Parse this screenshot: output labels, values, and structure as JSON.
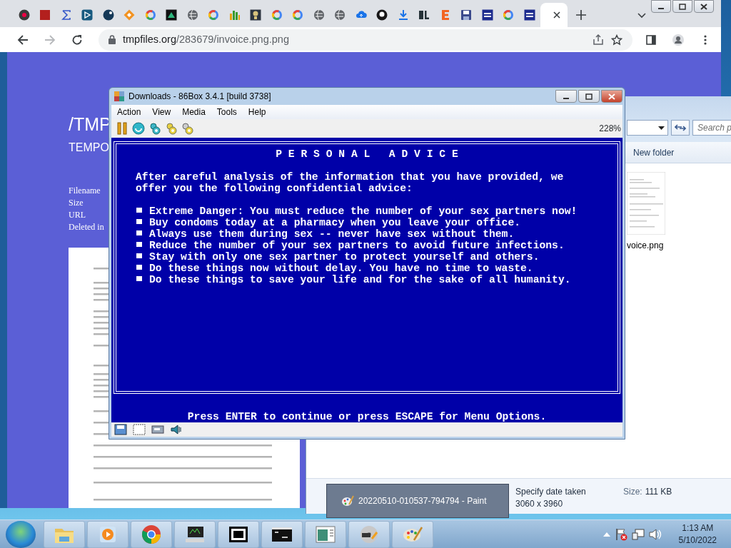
{
  "browser": {
    "tabs": [
      {
        "kind": "vb",
        "selected": false
      },
      {
        "kind": "red",
        "selected": false
      },
      {
        "kind": "sigma",
        "selected": false
      },
      {
        "kind": "play",
        "selected": false
      },
      {
        "kind": "dark",
        "selected": false
      },
      {
        "kind": "diamond",
        "selected": false
      },
      {
        "kind": "google",
        "selected": false
      },
      {
        "kind": "triangle",
        "selected": false
      },
      {
        "kind": "globe",
        "selected": false
      },
      {
        "kind": "google",
        "selected": false
      },
      {
        "kind": "chart",
        "selected": false
      },
      {
        "kind": "help",
        "selected": false
      },
      {
        "kind": "google",
        "selected": false
      },
      {
        "kind": "google",
        "selected": false
      },
      {
        "kind": "globe",
        "selected": false
      },
      {
        "kind": "globe",
        "selected": false
      },
      {
        "kind": "cloud",
        "selected": false
      },
      {
        "kind": "github",
        "selected": false
      },
      {
        "kind": "download",
        "selected": false
      },
      {
        "kind": "sl",
        "selected": false
      },
      {
        "kind": "e",
        "selected": false
      },
      {
        "kind": "save",
        "selected": false
      },
      {
        "kind": "sw",
        "selected": false
      },
      {
        "kind": "google",
        "selected": false
      },
      {
        "kind": "sw",
        "selected": false
      },
      {
        "kind": "blank",
        "selected": true
      }
    ],
    "address": {
      "domain": "tmpfiles.org",
      "path": "/283679/invoice.png.png"
    }
  },
  "page": {
    "title": "/TMP",
    "subtitle": "TEMPO",
    "labels": [
      "Filename",
      "Size",
      "URL",
      "Deleted in"
    ]
  },
  "explorer": {
    "search_placeholder": "Search p",
    "toolbar": [
      "New folder"
    ],
    "file": {
      "name": "voice.png"
    },
    "details": {
      "date": "Specify date taken",
      "dimensions": "3060 x 3960",
      "size_label": "Size:",
      "size": "111 KB"
    }
  },
  "emulator": {
    "title": "Downloads - 86Box 3.4.1 [build 3738]",
    "menu": [
      "Action",
      "View",
      "Media",
      "Tools",
      "Help"
    ],
    "zoom": "228%",
    "screen": {
      "heading": "P E R S O N A L   A D V I C E",
      "intro": [
        "After careful analysis of the information that you have provided, we",
        "offer you the following confidential advice:"
      ],
      "advice": [
        "Extreme Danger: You must reduce the number of your sex partners now!",
        "Buy condoms today at a pharmacy when you leave your office.",
        "Always use them during sex -- never have sex without them.",
        "Reduce the number of your sex partners to avoid future infections.",
        "Stay with only one sex partner to protect yourself and others.",
        "Do these things now without delay. You have no time to waste.",
        "Do these things to save your life and for the sake of all humanity."
      ],
      "prompt": "Press ENTER to continue or press ESCAPE for Menu Options."
    }
  },
  "paint_preview": {
    "title": "20220510-010537-794794 - Paint"
  },
  "taskbar": {
    "apps": [
      {
        "kind": "folder"
      },
      {
        "kind": "media"
      },
      {
        "kind": "browser"
      },
      {
        "kind": "monitor"
      },
      {
        "kind": "archive"
      },
      {
        "kind": "terminal"
      },
      {
        "kind": "window"
      },
      {
        "kind": "disc"
      },
      {
        "kind": "paint"
      }
    ],
    "clock": {
      "time": "1:13 AM",
      "date": "5/10/2022"
    }
  }
}
